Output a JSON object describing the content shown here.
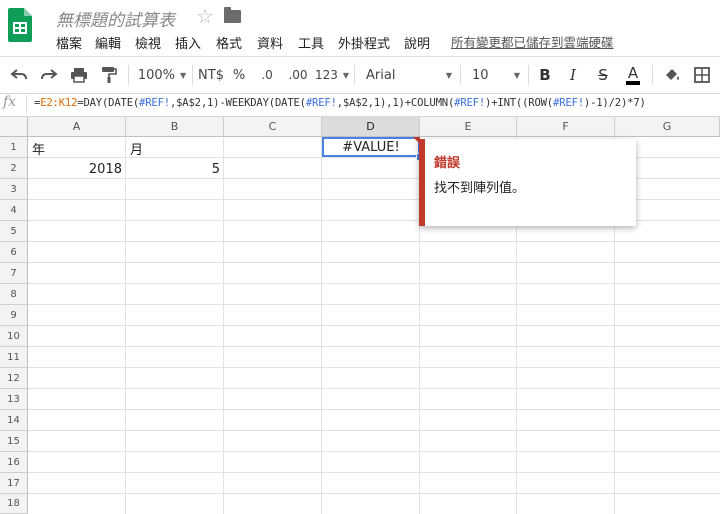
{
  "app": {
    "doc_title": "無標題的試算表",
    "save_status": "所有變更都已儲存到雲端硬碟",
    "menu": [
      "檔案",
      "編輯",
      "檢視",
      "插入",
      "格式",
      "資料",
      "工具",
      "外掛程式",
      "說明"
    ]
  },
  "toolbar": {
    "zoom": "100%",
    "currency": "NT$",
    "percent": "%",
    "dec_decrease": ".0",
    "dec_increase": ".00",
    "more_formats": "123",
    "font": "Arial",
    "font_size": "10",
    "bold": "B",
    "italic": "I",
    "strike": "S",
    "text_color": "A"
  },
  "formula_bar": {
    "fx": "fx",
    "parts": [
      {
        "text": "=",
        "color": "plain"
      },
      {
        "text": "E2:K12",
        "color": "orange"
      },
      {
        "text": "=DAY(DATE(",
        "color": "plain"
      },
      {
        "text": "#REF!",
        "color": "blue"
      },
      {
        "text": ",$A$2,1)-WEEKDAY(DATE(",
        "color": "plain"
      },
      {
        "text": "#REF!",
        "color": "blue"
      },
      {
        "text": ",$A$2,1),1)+COLUMN(",
        "color": "plain"
      },
      {
        "text": "#REF!",
        "color": "blue"
      },
      {
        "text": ")+INT((ROW(",
        "color": "plain"
      },
      {
        "text": "#REF!",
        "color": "blue"
      },
      {
        "text": ")-1)/2)*7)",
        "color": "plain"
      }
    ]
  },
  "sheet": {
    "columns": [
      "A",
      "B",
      "C",
      "D",
      "E",
      "F",
      "G"
    ],
    "selected_column": "D",
    "rows": [
      "1",
      "2",
      "3",
      "4",
      "5",
      "6",
      "7",
      "8",
      "9",
      "10",
      "11",
      "12",
      "13",
      "14",
      "15",
      "16",
      "17",
      "18"
    ],
    "cells": {
      "A1": "年",
      "B1": "月",
      "A2": "2018",
      "B2": "5",
      "D1": "#VALUE!"
    }
  },
  "error_popup": {
    "title": "錯誤",
    "message": "找不到陣列值。"
  },
  "colors": {
    "accent_blue": "#4a7fe8",
    "error_red": "#c0392b",
    "sheets_green": "#0f9d58"
  }
}
